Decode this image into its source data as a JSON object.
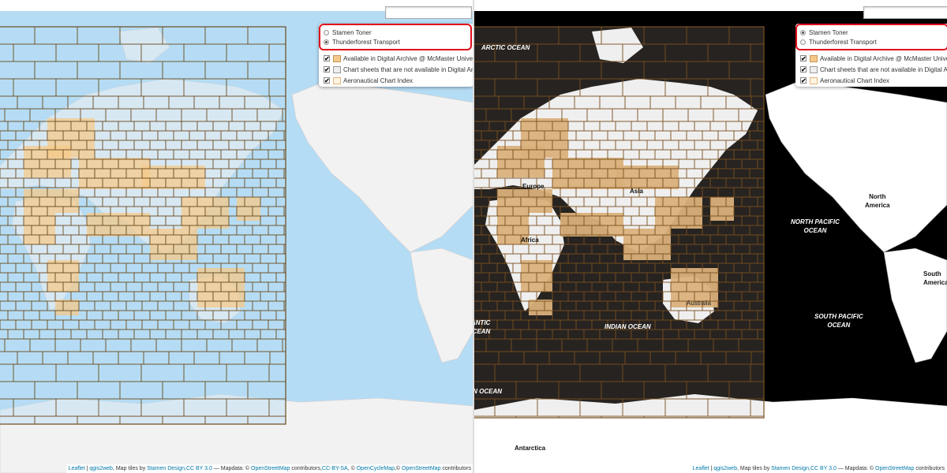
{
  "colors": {
    "ocean_light": "#b5dcf5",
    "land_light": "#f2f2f2",
    "ocean_dark": "#000000",
    "land_dark": "#ffffff",
    "grid_line": "#6b4a1e",
    "available_fill": "#f5c98a",
    "available_fill_dark": "#d9b07a",
    "index_dark": "#2a2623",
    "highlight": "#e0101c"
  },
  "layer_control": {
    "basemaps": [
      {
        "label": "Stamen Toner",
        "selected_left": false,
        "selected_right": true
      },
      {
        "label": "Thunderforest Transport",
        "selected_left": true,
        "selected_right": false
      }
    ],
    "overlays": [
      {
        "label": "Available in Digital Archive @ McMaster University",
        "checked": true,
        "swatch": "#f5c98a"
      },
      {
        "label": "Chart sheets that are not available in Digital Archive",
        "checked": true,
        "swatch": "#eeeeee"
      },
      {
        "label": "Aeronautical Chart Index",
        "checked": true,
        "swatch": "#fff4e4"
      }
    ]
  },
  "map_labels": {
    "arctic_ocean": "ARCTIC OCEAN",
    "europe": "Europe",
    "asia": "Asia",
    "africa": "Africa",
    "australia": "Australia",
    "north_america": "North\nAmerica",
    "south_america": "South\nAmerica",
    "north_pacific": "NORTH PACIFIC\nOCEAN",
    "south_pacific": "SOUTH PACIFIC\nOCEAN",
    "south_atlantic": "SOUTH ATLANTIC\nOCEAN",
    "indian_ocean": "INDIAN OCEAN",
    "southern_ocean": "SOUTHERN OCEAN",
    "antarctica": "Antarctica"
  },
  "attribution_left": {
    "leaflet": "Leaflet",
    "sep": " | ",
    "qgis2web": "qgis2web",
    "tiles_prefix": ", Map tiles by ",
    "stamen": "Stamen Design",
    "ccby": "CC BY 3.0",
    "mapdata": " — Mapdata: © ",
    "osm": "OpenStreetMap",
    "contrib": " contributors,",
    "ccbysa": "CC-BY-SA",
    "comma": ", © ",
    "ocm": "OpenCycleMap",
    "comma2": ",© ",
    "osm2": "OpenStreetMap",
    "tail": " contributors"
  },
  "attribution_right": {
    "leaflet": "Leaflet",
    "sep": " | ",
    "qgis2web": "qgis2web",
    "tiles_prefix": ", Map tiles by ",
    "stamen": "Stamen Design",
    "ccby": "CC BY 3.0",
    "mapdata": " — Mapdata: © ",
    "osm": "OpenStreetMap",
    "tail": " contributors"
  }
}
